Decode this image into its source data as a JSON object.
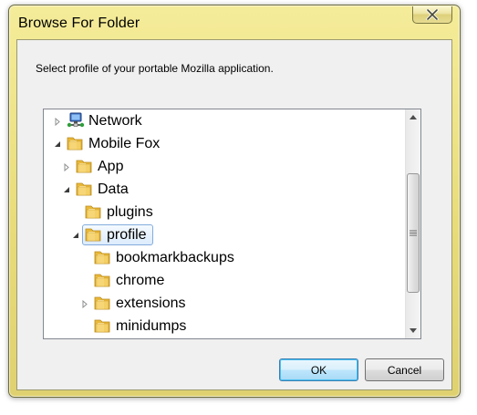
{
  "window": {
    "title": "Browse For Folder",
    "prompt": "Select profile of your portable Mozilla application."
  },
  "tree": {
    "items": [
      {
        "label": "Network",
        "icon": "network-icon",
        "expander": "collapsed",
        "level": 0
      },
      {
        "label": "Mobile Fox",
        "icon": "folder-icon",
        "expander": "expanded",
        "level": 0
      },
      {
        "label": "App",
        "icon": "folder-icon",
        "expander": "collapsed",
        "level": 1
      },
      {
        "label": "Data",
        "icon": "folder-icon",
        "expander": "expanded",
        "level": 1
      },
      {
        "label": "plugins",
        "icon": "folder-icon",
        "expander": "none",
        "level": 2
      },
      {
        "label": "profile",
        "icon": "folder-icon",
        "expander": "expanded",
        "level": 2,
        "selected": true
      },
      {
        "label": "bookmarkbackups",
        "icon": "folder-icon",
        "expander": "none",
        "level": 3
      },
      {
        "label": "chrome",
        "icon": "folder-icon",
        "expander": "none",
        "level": 3
      },
      {
        "label": "extensions",
        "icon": "folder-icon",
        "expander": "collapsed",
        "level": 3
      },
      {
        "label": "minidumps",
        "icon": "folder-icon",
        "expander": "none",
        "level": 3
      }
    ]
  },
  "buttons": {
    "ok": "OK",
    "cancel": "Cancel"
  },
  "colors": {
    "frame": "#e8dc7a",
    "selection_border": "#7da2ce",
    "folder": "#f2c94c"
  }
}
